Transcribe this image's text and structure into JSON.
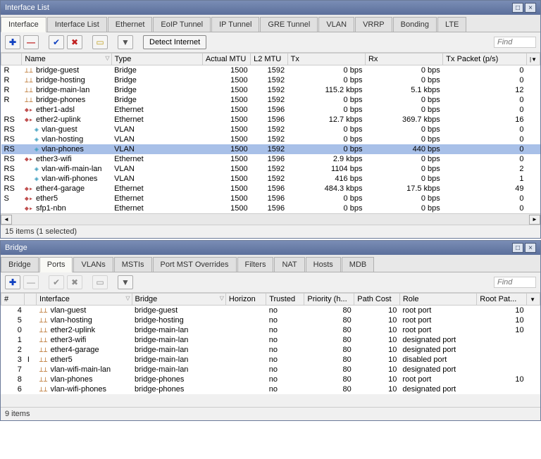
{
  "win1": {
    "title": "Interface List",
    "tabs": [
      "Interface",
      "Interface List",
      "Ethernet",
      "EoIP Tunnel",
      "IP Tunnel",
      "GRE Tunnel",
      "VLAN",
      "VRRP",
      "Bonding",
      "LTE"
    ],
    "activeTab": 0,
    "detect": "Detect Internet",
    "find": "Find",
    "cols": [
      "",
      "Name",
      "Type",
      "Actual MTU",
      "L2 MTU",
      "Tx",
      "Rx",
      "Tx Packet (p/s)"
    ],
    "rows": [
      {
        "f": "R",
        "ic": "br",
        "ind": 0,
        "name": "bridge-guest",
        "type": "Bridge",
        "mtu": "1500",
        "l2": "1592",
        "tx": "0 bps",
        "rx": "0 bps",
        "txp": "0"
      },
      {
        "f": "R",
        "ic": "br",
        "ind": 0,
        "name": "bridge-hosting",
        "type": "Bridge",
        "mtu": "1500",
        "l2": "1592",
        "tx": "0 bps",
        "rx": "0 bps",
        "txp": "0"
      },
      {
        "f": "R",
        "ic": "br",
        "ind": 0,
        "name": "bridge-main-lan",
        "type": "Bridge",
        "mtu": "1500",
        "l2": "1592",
        "tx": "115.2 kbps",
        "rx": "5.1 kbps",
        "txp": "12"
      },
      {
        "f": "R",
        "ic": "br",
        "ind": 0,
        "name": "bridge-phones",
        "type": "Bridge",
        "mtu": "1500",
        "l2": "1592",
        "tx": "0 bps",
        "rx": "0 bps",
        "txp": "0"
      },
      {
        "f": "",
        "ic": "eth",
        "ind": 0,
        "name": "ether1-adsl",
        "type": "Ethernet",
        "mtu": "1500",
        "l2": "1596",
        "tx": "0 bps",
        "rx": "0 bps",
        "txp": "0"
      },
      {
        "f": "RS",
        "ic": "eth",
        "ind": 0,
        "name": "ether2-uplink",
        "type": "Ethernet",
        "mtu": "1500",
        "l2": "1596",
        "tx": "12.7 kbps",
        "rx": "369.7 kbps",
        "txp": "16"
      },
      {
        "f": "RS",
        "ic": "vl",
        "ind": 1,
        "name": "vlan-guest",
        "type": "VLAN",
        "mtu": "1500",
        "l2": "1592",
        "tx": "0 bps",
        "rx": "0 bps",
        "txp": "0"
      },
      {
        "f": "RS",
        "ic": "vl",
        "ind": 1,
        "name": "vlan-hosting",
        "type": "VLAN",
        "mtu": "1500",
        "l2": "1592",
        "tx": "0 bps",
        "rx": "0 bps",
        "txp": "0"
      },
      {
        "f": "RS",
        "ic": "vl",
        "ind": 1,
        "name": "vlan-phones",
        "type": "VLAN",
        "mtu": "1500",
        "l2": "1592",
        "tx": "0 bps",
        "rx": "440 bps",
        "txp": "0",
        "sel": true
      },
      {
        "f": "RS",
        "ic": "eth",
        "ind": 0,
        "name": "ether3-wifi",
        "type": "Ethernet",
        "mtu": "1500",
        "l2": "1596",
        "tx": "2.9 kbps",
        "rx": "0 bps",
        "txp": "0"
      },
      {
        "f": "RS",
        "ic": "vl",
        "ind": 1,
        "name": "vlan-wifi-main-lan",
        "type": "VLAN",
        "mtu": "1500",
        "l2": "1592",
        "tx": "1104 bps",
        "rx": "0 bps",
        "txp": "2"
      },
      {
        "f": "RS",
        "ic": "vl",
        "ind": 1,
        "name": "vlan-wifi-phones",
        "type": "VLAN",
        "mtu": "1500",
        "l2": "1592",
        "tx": "416 bps",
        "rx": "0 bps",
        "txp": "1"
      },
      {
        "f": "RS",
        "ic": "eth",
        "ind": 0,
        "name": "ether4-garage",
        "type": "Ethernet",
        "mtu": "1500",
        "l2": "1596",
        "tx": "484.3 kbps",
        "rx": "17.5 kbps",
        "txp": "49"
      },
      {
        "f": "S",
        "ic": "eth",
        "ind": 0,
        "name": "ether5",
        "type": "Ethernet",
        "mtu": "1500",
        "l2": "1596",
        "tx": "0 bps",
        "rx": "0 bps",
        "txp": "0"
      },
      {
        "f": "",
        "ic": "eth",
        "ind": 0,
        "name": "sfp1-nbn",
        "type": "Ethernet",
        "mtu": "1500",
        "l2": "1596",
        "tx": "0 bps",
        "rx": "0 bps",
        "txp": "0"
      }
    ],
    "status": "15 items (1 selected)"
  },
  "win2": {
    "title": "Bridge",
    "tabs": [
      "Bridge",
      "Ports",
      "VLANs",
      "MSTIs",
      "Port MST Overrides",
      "Filters",
      "NAT",
      "Hosts",
      "MDB"
    ],
    "activeTab": 1,
    "find": "Find",
    "cols": [
      "#",
      "",
      "Interface",
      "Bridge",
      "Horizon",
      "Trusted",
      "Priority (h...",
      "Path Cost",
      "Role",
      "Root Pat..."
    ],
    "rows": [
      {
        "n": "4",
        "x": "",
        "iface": "vlan-guest",
        "br": "bridge-guest",
        "tr": "no",
        "pr": "80",
        "pc": "10",
        "role": "root port",
        "rp": "10"
      },
      {
        "n": "5",
        "x": "",
        "iface": "vlan-hosting",
        "br": "bridge-hosting",
        "tr": "no",
        "pr": "80",
        "pc": "10",
        "role": "root port",
        "rp": "10"
      },
      {
        "n": "0",
        "x": "",
        "iface": "ether2-uplink",
        "br": "bridge-main-lan",
        "tr": "no",
        "pr": "80",
        "pc": "10",
        "role": "root port",
        "rp": "10"
      },
      {
        "n": "1",
        "x": "",
        "iface": "ether3-wifi",
        "br": "bridge-main-lan",
        "tr": "no",
        "pr": "80",
        "pc": "10",
        "role": "designated port",
        "rp": ""
      },
      {
        "n": "2",
        "x": "",
        "iface": "ether4-garage",
        "br": "bridge-main-lan",
        "tr": "no",
        "pr": "80",
        "pc": "10",
        "role": "designated port",
        "rp": ""
      },
      {
        "n": "3",
        "x": "I",
        "iface": "ether5",
        "br": "bridge-main-lan",
        "tr": "no",
        "pr": "80",
        "pc": "10",
        "role": "disabled port",
        "rp": ""
      },
      {
        "n": "7",
        "x": "",
        "iface": "vlan-wifi-main-lan",
        "br": "bridge-main-lan",
        "tr": "no",
        "pr": "80",
        "pc": "10",
        "role": "designated port",
        "rp": ""
      },
      {
        "n": "8",
        "x": "",
        "iface": "vlan-phones",
        "br": "bridge-phones",
        "tr": "no",
        "pr": "80",
        "pc": "10",
        "role": "root port",
        "rp": "10"
      },
      {
        "n": "6",
        "x": "",
        "iface": "vlan-wifi-phones",
        "br": "bridge-phones",
        "tr": "no",
        "pr": "80",
        "pc": "10",
        "role": "designated port",
        "rp": ""
      }
    ],
    "status": "9 items"
  }
}
